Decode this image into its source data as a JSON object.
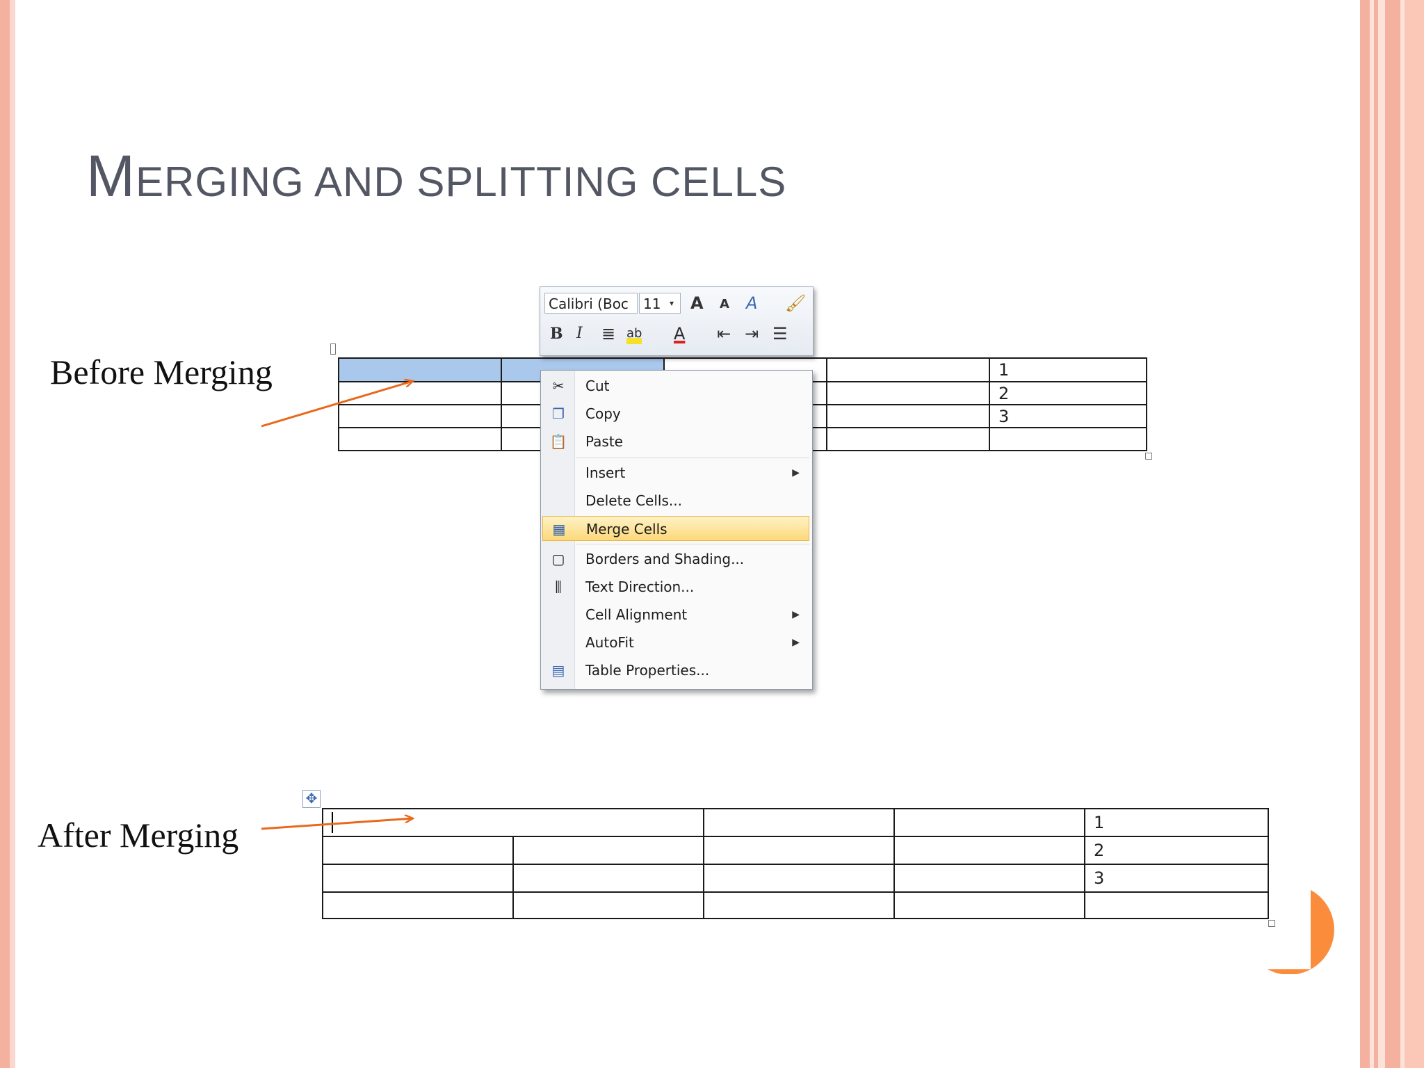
{
  "slide": {
    "title_first": "M",
    "title_rest": "ERGING AND SPLITTING CELLS",
    "caption_before": "Before Merging",
    "caption_after": "After Merging"
  },
  "mini_toolbar": {
    "font_name": "Calibri (Boc",
    "font_size": "11",
    "icons": [
      "dropdown-arrow-icon",
      "grow-font-icon",
      "shrink-font-icon",
      "styles-icon",
      "format-painter-icon",
      "bold-icon",
      "italic-icon",
      "center-align-icon",
      "highlight-icon",
      "font-color-icon",
      "decrease-indent-icon",
      "increase-indent-icon",
      "bullets-icon"
    ]
  },
  "context_menu": {
    "items": [
      {
        "label": "Cut",
        "icon": "scissors-icon"
      },
      {
        "label": "Copy",
        "icon": "copy-icon"
      },
      {
        "label": "Paste",
        "icon": "paste-icon"
      },
      {
        "label": "Insert",
        "icon": "",
        "submenu": true
      },
      {
        "label": "Delete Cells...",
        "icon": ""
      },
      {
        "label": "Merge Cells",
        "icon": "merge-cells-icon",
        "highlighted": true
      },
      {
        "label": "Borders and Shading...",
        "icon": "borders-icon"
      },
      {
        "label": "Text Direction...",
        "icon": "text-direction-icon"
      },
      {
        "label": "Cell Alignment",
        "icon": "",
        "submenu": true
      },
      {
        "label": "AutoFit",
        "icon": "",
        "submenu": true
      },
      {
        "label": "Table Properties...",
        "icon": "table-properties-icon"
      }
    ]
  },
  "before_table": {
    "rows": [
      [
        "",
        "",
        "",
        "",
        "1"
      ],
      [
        "",
        "",
        "",
        "",
        "2"
      ],
      [
        "",
        "",
        "",
        "",
        "3"
      ],
      [
        "",
        "",
        "",
        "",
        ""
      ]
    ]
  },
  "after_table": {
    "rows": [
      [
        "",
        "",
        "",
        "1"
      ],
      [
        "",
        "",
        "",
        "",
        "2"
      ],
      [
        "",
        "",
        "",
        "",
        "3"
      ],
      [
        "",
        "",
        "",
        "",
        ""
      ]
    ]
  },
  "colors": {
    "accent": "#f4b1a0",
    "highlight": "#fcd97a",
    "selection": "#a9c8ec",
    "arrow": "#e8691c",
    "circle": "#fb8c3c"
  }
}
